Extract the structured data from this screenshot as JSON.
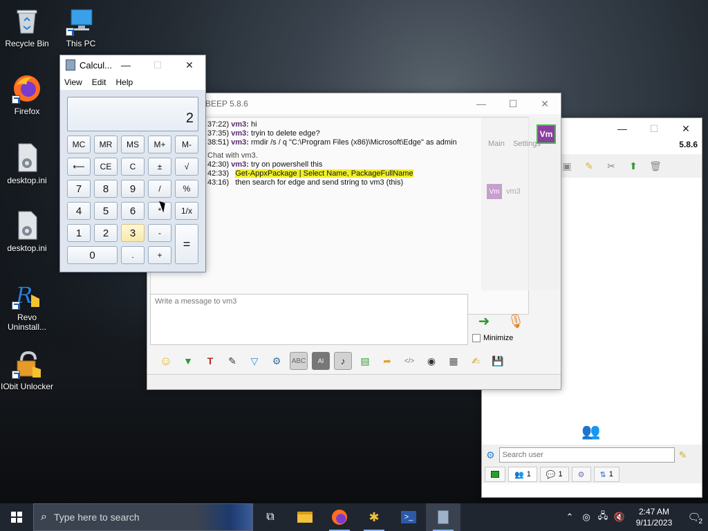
{
  "desktop": {
    "icons": [
      {
        "label": "Recycle Bin",
        "icon": "recycle-bin-icon"
      },
      {
        "label": "This PC",
        "icon": "this-pc-icon"
      },
      {
        "label": "Firefox",
        "icon": "firefox-icon"
      },
      {
        "label": "desktop.ini",
        "icon": "settings-file-icon"
      },
      {
        "label": "desktop.ini",
        "icon": "settings-file-icon"
      },
      {
        "label": "Revo Uninstall...",
        "icon": "revo-uninstaller-icon"
      },
      {
        "label": "IObit Unlocker",
        "icon": "iobit-unlocker-icon"
      }
    ]
  },
  "calculator": {
    "title": "Calcul...",
    "menu": [
      "View",
      "Edit",
      "Help"
    ],
    "display": "2",
    "buttons": {
      "mc": "MC",
      "mr": "MR",
      "ms": "MS",
      "mplus": "M+",
      "mminus": "M-",
      "back": "⟵",
      "ce": "CE",
      "c": "C",
      "plusminus": "±",
      "sqrt": "√",
      "n7": "7",
      "n8": "8",
      "n9": "9",
      "div": "/",
      "pct": "%",
      "n4": "4",
      "n5": "5",
      "n6": "6",
      "mul": "*",
      "recip": "1/x",
      "n1": "1",
      "n2": "2",
      "n3": "3",
      "sub": "-",
      "eq": "=",
      "n0": "0",
      "dot": ".",
      "add": "+"
    }
  },
  "beep_chat": {
    "title": "BEEP 5.8.6",
    "lines": [
      {
        "time": "37:22)",
        "nick": "vm3:",
        "text": "hi"
      },
      {
        "time": "37:35)",
        "nick": "vm3:",
        "text": "tryin to delete edge?"
      },
      {
        "time": "38:51)",
        "nick": "vm3:",
        "text": "rmdir /s / q \"C:\\Program Files (x86)\\Microsoft\\Edge\" as admin"
      }
    ],
    "session_notice": "Chat with vm3.",
    "lines2": [
      {
        "time": "42:30)",
        "nick": "vm3:",
        "text": "try on powershell this"
      },
      {
        "time": "42:33)",
        "nick": "",
        "text": "Get-AppxPackage | Select Name, PackageFullName",
        "highlight": true
      },
      {
        "time": "43:16)",
        "nick": "",
        "text": "then search for edge and send string to vm3 (this)"
      }
    ],
    "compose_placeholder": "Write a message to vm3",
    "minimize_label": "Minimize"
  },
  "beep_main": {
    "tabs": [
      "Main",
      "Settings"
    ],
    "version": "5.8.6",
    "contact": "vm3",
    "contact_badge": "Vm",
    "search_placeholder": "Search user",
    "bottom_tabs": [
      {
        "icon": "users-icon",
        "count": "1"
      },
      {
        "icon": "chat-icon",
        "count": "1"
      },
      {
        "icon": "group-icon",
        "count": ""
      },
      {
        "icon": "transfer-icon",
        "count": "1"
      }
    ]
  },
  "taskbar": {
    "search_placeholder": "Type here to search",
    "time": "2:47 AM",
    "date": "9/11/2023",
    "notification_count": "2",
    "apps": [
      "task-view-icon",
      "file-explorer-icon",
      "firefox-icon",
      "beep-icon",
      "powershell-icon",
      "calculator-icon"
    ]
  }
}
